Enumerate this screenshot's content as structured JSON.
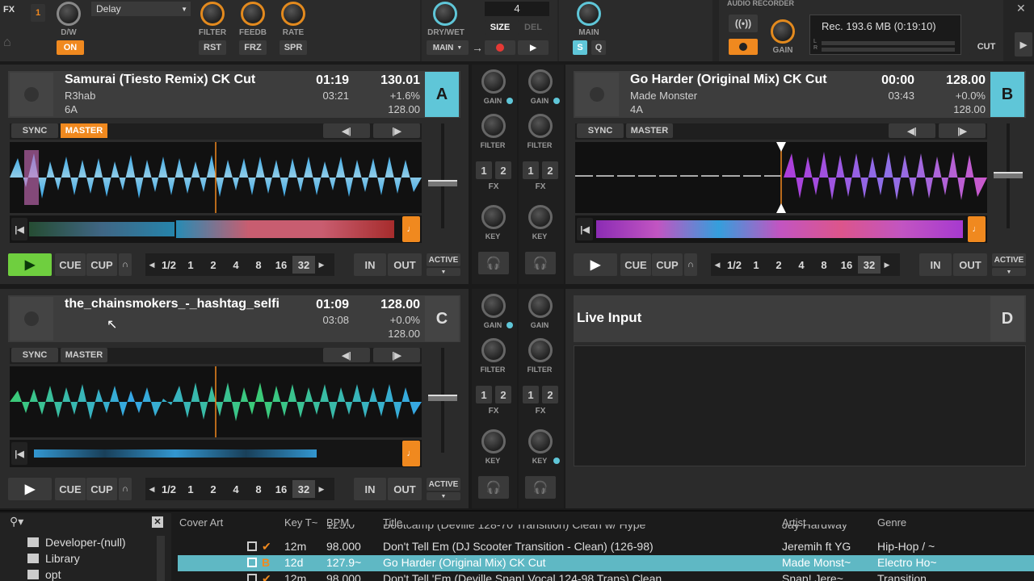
{
  "top": {
    "fx_label": "FX",
    "fx_unit": "1",
    "effect_name": "Delay",
    "dw_label": "D/W",
    "on_label": "ON",
    "knobs": [
      {
        "label": "FILTER",
        "btn": "RST"
      },
      {
        "label": "FEEDB",
        "btn": "FRZ"
      },
      {
        "label": "RATE",
        "btn": "SPR"
      }
    ],
    "dry_wet_label": "DRY/WET",
    "main_select": "MAIN",
    "size_value": "4",
    "size_label": "SIZE",
    "del_label": "DEL",
    "main_label": "MAIN",
    "s_btn": "S",
    "q_btn": "Q",
    "audio_recorder_label": "AUDIO RECORDER",
    "rec_status": "Rec. 193.6 MB (0:19:10)",
    "gain_label": "GAIN",
    "cut_label": "CUT",
    "close_glyph": "✕"
  },
  "decks": {
    "a": {
      "letter": "A",
      "title": "Samurai (Tiesto Remix) CK Cut",
      "artist": "R3hab",
      "key": "6A",
      "elapsed": "01:19",
      "remaining": "03:21",
      "bpm": "130.01",
      "pitch": "+1.6%",
      "base_bpm": "128.00",
      "sync": "SYNC",
      "master": "MASTER",
      "cue": "CUE",
      "cup": "CUP",
      "loops": [
        "1/2",
        "1",
        "2",
        "4",
        "8",
        "16",
        "32"
      ],
      "in": "IN",
      "out": "OUT",
      "active": "ACTIVE"
    },
    "b": {
      "letter": "B",
      "title": "Go Harder (Original Mix) CK Cut",
      "artist": "Made Monster",
      "key": "4A",
      "elapsed": "00:00",
      "remaining": "03:43",
      "bpm": "128.00",
      "pitch": "+0.0%",
      "base_bpm": "128.00",
      "sync": "SYNC",
      "master": "MASTER",
      "cue": "CUE",
      "cup": "CUP",
      "loops": [
        "1/2",
        "1",
        "2",
        "4",
        "8",
        "16",
        "32"
      ],
      "in": "IN",
      "out": "OUT",
      "active": "ACTIVE"
    },
    "c": {
      "letter": "C",
      "title": "the_chainsmokers_-_hashtag_selfi",
      "elapsed": "01:09",
      "remaining": "03:08",
      "bpm": "128.00",
      "pitch": "+0.0%",
      "base_bpm": "128.00",
      "sync": "SYNC",
      "master": "MASTER",
      "cue": "CUE",
      "cup": "CUP",
      "loops": [
        "1/2",
        "1",
        "2",
        "4",
        "8",
        "16",
        "32"
      ],
      "in": "IN",
      "out": "OUT",
      "active": "ACTIVE"
    },
    "d": {
      "letter": "D",
      "title": "Live Input"
    }
  },
  "mixer": {
    "gain": "GAIN",
    "filter": "FILTER",
    "fx": "FX",
    "key": "KEY",
    "fx1": "1",
    "fx2": "2"
  },
  "browser": {
    "tree": [
      "Developer-(null)",
      "Library",
      "opt"
    ],
    "columns": [
      "Cover Art",
      "Key T~",
      "BPM",
      "Title",
      "Artist",
      "Genre"
    ],
    "rows": [
      {
        "key": "",
        "bpm": "125.0",
        "title": "Bootcamp (Deville 128-70 Transition) Clean w/ Hype",
        "artist": "Jay Hardway",
        "genre": ""
      },
      {
        "key": "12m",
        "bpm": "98.000",
        "title": "Don't Tell Em (DJ Scooter Transition - Clean) (126-98)",
        "artist": "Jeremih ft YG",
        "genre": "Hip-Hop / ~"
      },
      {
        "key": "12d",
        "bpm": "127.9~",
        "title": "Go Harder (Original Mix) CK Cut",
        "artist": "Made Monst~",
        "genre": "Electro Ho~",
        "deck": "B",
        "selected": true
      },
      {
        "key": "12m",
        "bpm": "98.000",
        "title": "Don't Tell 'Em (Deville Snap! Vocal 124-98 Trans) Clean",
        "artist": "Snap! Jere~",
        "genre": "Transition"
      }
    ]
  }
}
